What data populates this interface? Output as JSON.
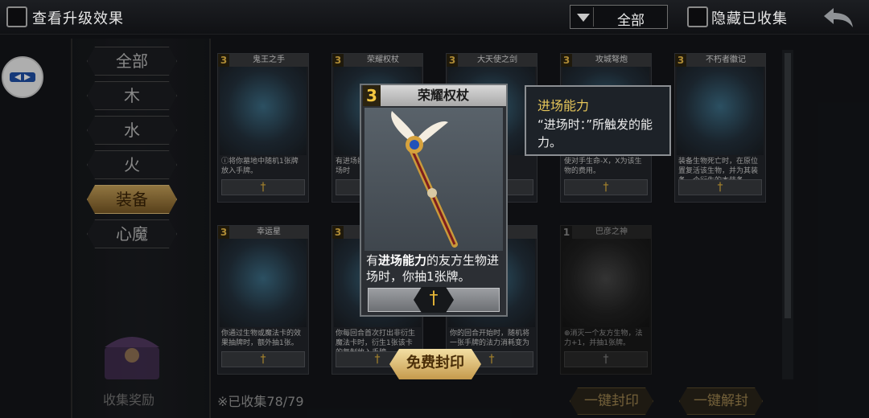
{
  "topbar": {
    "upgrade_label": "查看升级效果",
    "filter_value": "全部",
    "hide_label": "隐藏已收集"
  },
  "categories": [
    {
      "label": "全部"
    },
    {
      "label": "木"
    },
    {
      "label": "水"
    },
    {
      "label": "火"
    },
    {
      "label": "装备",
      "active": true
    },
    {
      "label": "心魔"
    }
  ],
  "cards": [
    {
      "cost": "3",
      "name": "鬼王之手",
      "desc": "ⓘ将你墓地中随机1张牌放入手牌。"
    },
    {
      "cost": "3",
      "name": "荣耀权杖",
      "desc": "有进场能力的友方生物进场时"
    },
    {
      "cost": "3",
      "name": "大天使之剑",
      "desc": "攻。"
    },
    {
      "cost": "3",
      "name": "攻城弩炮",
      "desc": "使对手生命-X，X为该生物的费用。"
    },
    {
      "cost": "3",
      "name": "不朽者徽记",
      "desc": "装备生物死亡时，在原位置复活该生物，并为其装备一个衍生的本装备。"
    },
    {
      "cost": "3",
      "name": "幸运星",
      "desc": "你通过生物或魔法卡的效果抽牌时，额外抽1张。"
    },
    {
      "cost": "3",
      "name": "",
      "desc": "你每回合首次打出非衍生魔法卡时，衍生1张该卡的复制放入手牌。"
    },
    {
      "cost": "3",
      "name": "",
      "desc": "你的回合开始时，随机将一张手牌的法力消耗变为0。"
    },
    {
      "cost": "1",
      "name": "巴彦之神",
      "desc": "⊕消灭一个友方生物，法力+1，并抽1张牌。"
    }
  ],
  "footer": {
    "reward_label": "收集奖励",
    "collected_text": "※已收集78/79",
    "seal_all": "一键封印",
    "unseal_all": "一键解封"
  },
  "popup": {
    "cost": "3",
    "name": "荣耀权杖",
    "desc_pre": "有",
    "desc_bold": "进场能力",
    "desc_post": "的友方生物进场时，你抽1张牌。",
    "free_seal": "免费封印"
  },
  "tooltip": {
    "title": "进场能力",
    "body": "“进场时：”所触发的能力。"
  },
  "colors": {
    "accent_gold": "#e3b53d",
    "bg": "#14161a",
    "active_tab": "#c9a35a"
  }
}
